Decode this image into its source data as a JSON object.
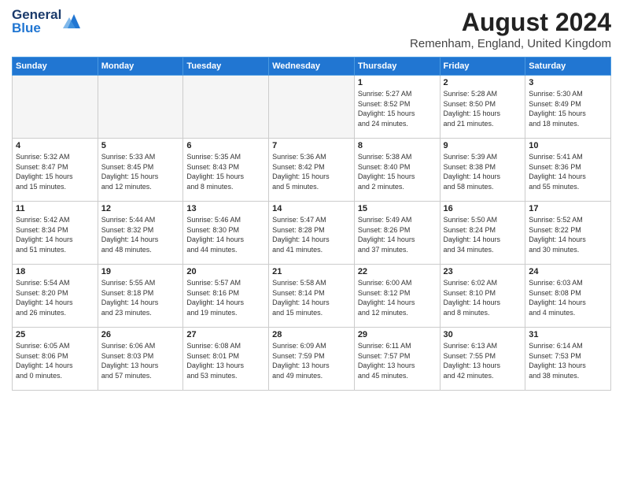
{
  "header": {
    "logo_general": "General",
    "logo_blue": "Blue",
    "month_year": "August 2024",
    "location": "Remenham, England, United Kingdom"
  },
  "days_of_week": [
    "Sunday",
    "Monday",
    "Tuesday",
    "Wednesday",
    "Thursday",
    "Friday",
    "Saturday"
  ],
  "weeks": [
    [
      {
        "day": "",
        "content": ""
      },
      {
        "day": "",
        "content": ""
      },
      {
        "day": "",
        "content": ""
      },
      {
        "day": "",
        "content": ""
      },
      {
        "day": "1",
        "content": "Sunrise: 5:27 AM\nSunset: 8:52 PM\nDaylight: 15 hours\nand 24 minutes."
      },
      {
        "day": "2",
        "content": "Sunrise: 5:28 AM\nSunset: 8:50 PM\nDaylight: 15 hours\nand 21 minutes."
      },
      {
        "day": "3",
        "content": "Sunrise: 5:30 AM\nSunset: 8:49 PM\nDaylight: 15 hours\nand 18 minutes."
      }
    ],
    [
      {
        "day": "4",
        "content": "Sunrise: 5:32 AM\nSunset: 8:47 PM\nDaylight: 15 hours\nand 15 minutes."
      },
      {
        "day": "5",
        "content": "Sunrise: 5:33 AM\nSunset: 8:45 PM\nDaylight: 15 hours\nand 12 minutes."
      },
      {
        "day": "6",
        "content": "Sunrise: 5:35 AM\nSunset: 8:43 PM\nDaylight: 15 hours\nand 8 minutes."
      },
      {
        "day": "7",
        "content": "Sunrise: 5:36 AM\nSunset: 8:42 PM\nDaylight: 15 hours\nand 5 minutes."
      },
      {
        "day": "8",
        "content": "Sunrise: 5:38 AM\nSunset: 8:40 PM\nDaylight: 15 hours\nand 2 minutes."
      },
      {
        "day": "9",
        "content": "Sunrise: 5:39 AM\nSunset: 8:38 PM\nDaylight: 14 hours\nand 58 minutes."
      },
      {
        "day": "10",
        "content": "Sunrise: 5:41 AM\nSunset: 8:36 PM\nDaylight: 14 hours\nand 55 minutes."
      }
    ],
    [
      {
        "day": "11",
        "content": "Sunrise: 5:42 AM\nSunset: 8:34 PM\nDaylight: 14 hours\nand 51 minutes."
      },
      {
        "day": "12",
        "content": "Sunrise: 5:44 AM\nSunset: 8:32 PM\nDaylight: 14 hours\nand 48 minutes."
      },
      {
        "day": "13",
        "content": "Sunrise: 5:46 AM\nSunset: 8:30 PM\nDaylight: 14 hours\nand 44 minutes."
      },
      {
        "day": "14",
        "content": "Sunrise: 5:47 AM\nSunset: 8:28 PM\nDaylight: 14 hours\nand 41 minutes."
      },
      {
        "day": "15",
        "content": "Sunrise: 5:49 AM\nSunset: 8:26 PM\nDaylight: 14 hours\nand 37 minutes."
      },
      {
        "day": "16",
        "content": "Sunrise: 5:50 AM\nSunset: 8:24 PM\nDaylight: 14 hours\nand 34 minutes."
      },
      {
        "day": "17",
        "content": "Sunrise: 5:52 AM\nSunset: 8:22 PM\nDaylight: 14 hours\nand 30 minutes."
      }
    ],
    [
      {
        "day": "18",
        "content": "Sunrise: 5:54 AM\nSunset: 8:20 PM\nDaylight: 14 hours\nand 26 minutes."
      },
      {
        "day": "19",
        "content": "Sunrise: 5:55 AM\nSunset: 8:18 PM\nDaylight: 14 hours\nand 23 minutes."
      },
      {
        "day": "20",
        "content": "Sunrise: 5:57 AM\nSunset: 8:16 PM\nDaylight: 14 hours\nand 19 minutes."
      },
      {
        "day": "21",
        "content": "Sunrise: 5:58 AM\nSunset: 8:14 PM\nDaylight: 14 hours\nand 15 minutes."
      },
      {
        "day": "22",
        "content": "Sunrise: 6:00 AM\nSunset: 8:12 PM\nDaylight: 14 hours\nand 12 minutes."
      },
      {
        "day": "23",
        "content": "Sunrise: 6:02 AM\nSunset: 8:10 PM\nDaylight: 14 hours\nand 8 minutes."
      },
      {
        "day": "24",
        "content": "Sunrise: 6:03 AM\nSunset: 8:08 PM\nDaylight: 14 hours\nand 4 minutes."
      }
    ],
    [
      {
        "day": "25",
        "content": "Sunrise: 6:05 AM\nSunset: 8:06 PM\nDaylight: 14 hours\nand 0 minutes."
      },
      {
        "day": "26",
        "content": "Sunrise: 6:06 AM\nSunset: 8:03 PM\nDaylight: 13 hours\nand 57 minutes."
      },
      {
        "day": "27",
        "content": "Sunrise: 6:08 AM\nSunset: 8:01 PM\nDaylight: 13 hours\nand 53 minutes."
      },
      {
        "day": "28",
        "content": "Sunrise: 6:09 AM\nSunset: 7:59 PM\nDaylight: 13 hours\nand 49 minutes."
      },
      {
        "day": "29",
        "content": "Sunrise: 6:11 AM\nSunset: 7:57 PM\nDaylight: 13 hours\nand 45 minutes."
      },
      {
        "day": "30",
        "content": "Sunrise: 6:13 AM\nSunset: 7:55 PM\nDaylight: 13 hours\nand 42 minutes."
      },
      {
        "day": "31",
        "content": "Sunrise: 6:14 AM\nSunset: 7:53 PM\nDaylight: 13 hours\nand 38 minutes."
      }
    ]
  ]
}
